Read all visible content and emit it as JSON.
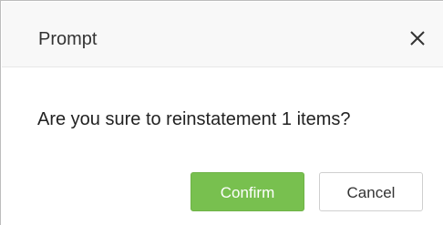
{
  "dialog": {
    "title": "Prompt",
    "message": "Are you sure to reinstatement 1 items?",
    "close_icon": "close-icon",
    "buttons": {
      "confirm_label": "Confirm",
      "cancel_label": "Cancel"
    }
  },
  "colors": {
    "confirm_background": "#78c04f",
    "header_background": "#f8f8f8"
  }
}
